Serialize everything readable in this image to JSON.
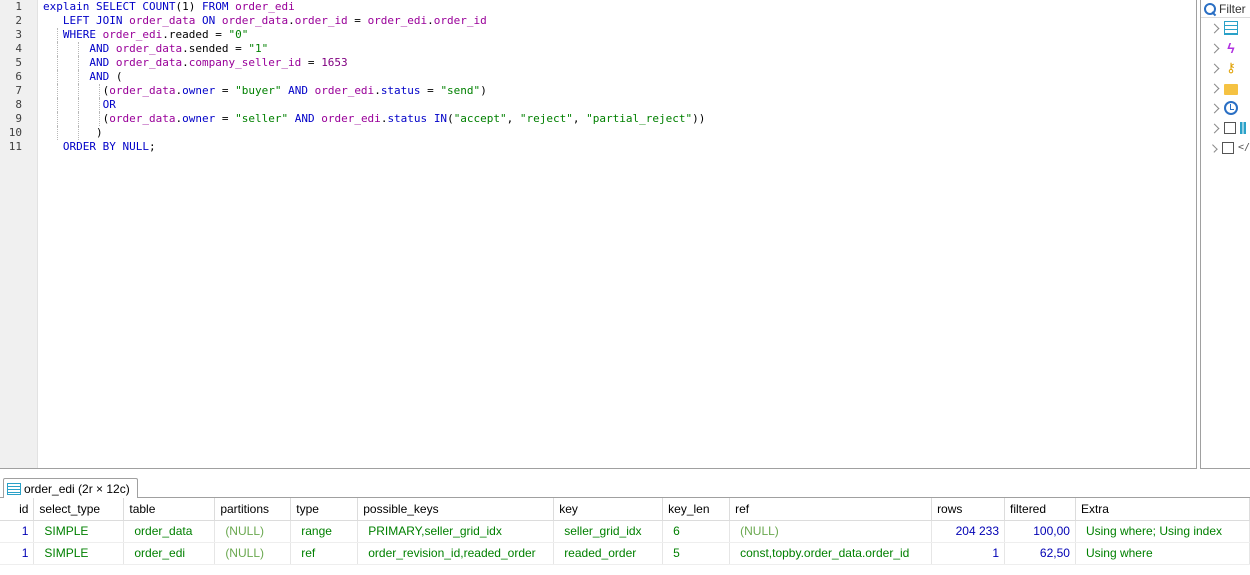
{
  "editor": {
    "line_numbers": [
      "1",
      "2",
      "3",
      "4",
      "5",
      "6",
      "7",
      "8",
      "9",
      "10",
      "11"
    ]
  },
  "sidepanel": {
    "filter_label": "Filter"
  },
  "result_tab": {
    "label": "order_edi (2r × 12c)"
  },
  "grid": {
    "columns": [
      "id",
      "select_type",
      "table",
      "partitions",
      "type",
      "possible_keys",
      "key",
      "key_len",
      "ref",
      "rows",
      "filtered",
      "Extra"
    ],
    "rows": [
      {
        "id": "1",
        "select_type": "SIMPLE",
        "table": "order_data",
        "partitions": "(NULL)",
        "type": "range",
        "possible_keys": "PRIMARY,seller_grid_idx",
        "key": "seller_grid_idx",
        "key_len": "6",
        "ref": "(NULL)",
        "rows": "204 233",
        "filtered": "100,00",
        "Extra": "Using where; Using index"
      },
      {
        "id": "1",
        "select_type": "SIMPLE",
        "table": "order_edi",
        "partitions": "(NULL)",
        "type": "ref",
        "possible_keys": "order_revision_id,readed_order",
        "key": "readed_order",
        "key_len": "5",
        "ref": "const,topby.order_data.order_id",
        "rows": "1",
        "filtered": "62,50",
        "Extra": "Using where"
      }
    ]
  }
}
